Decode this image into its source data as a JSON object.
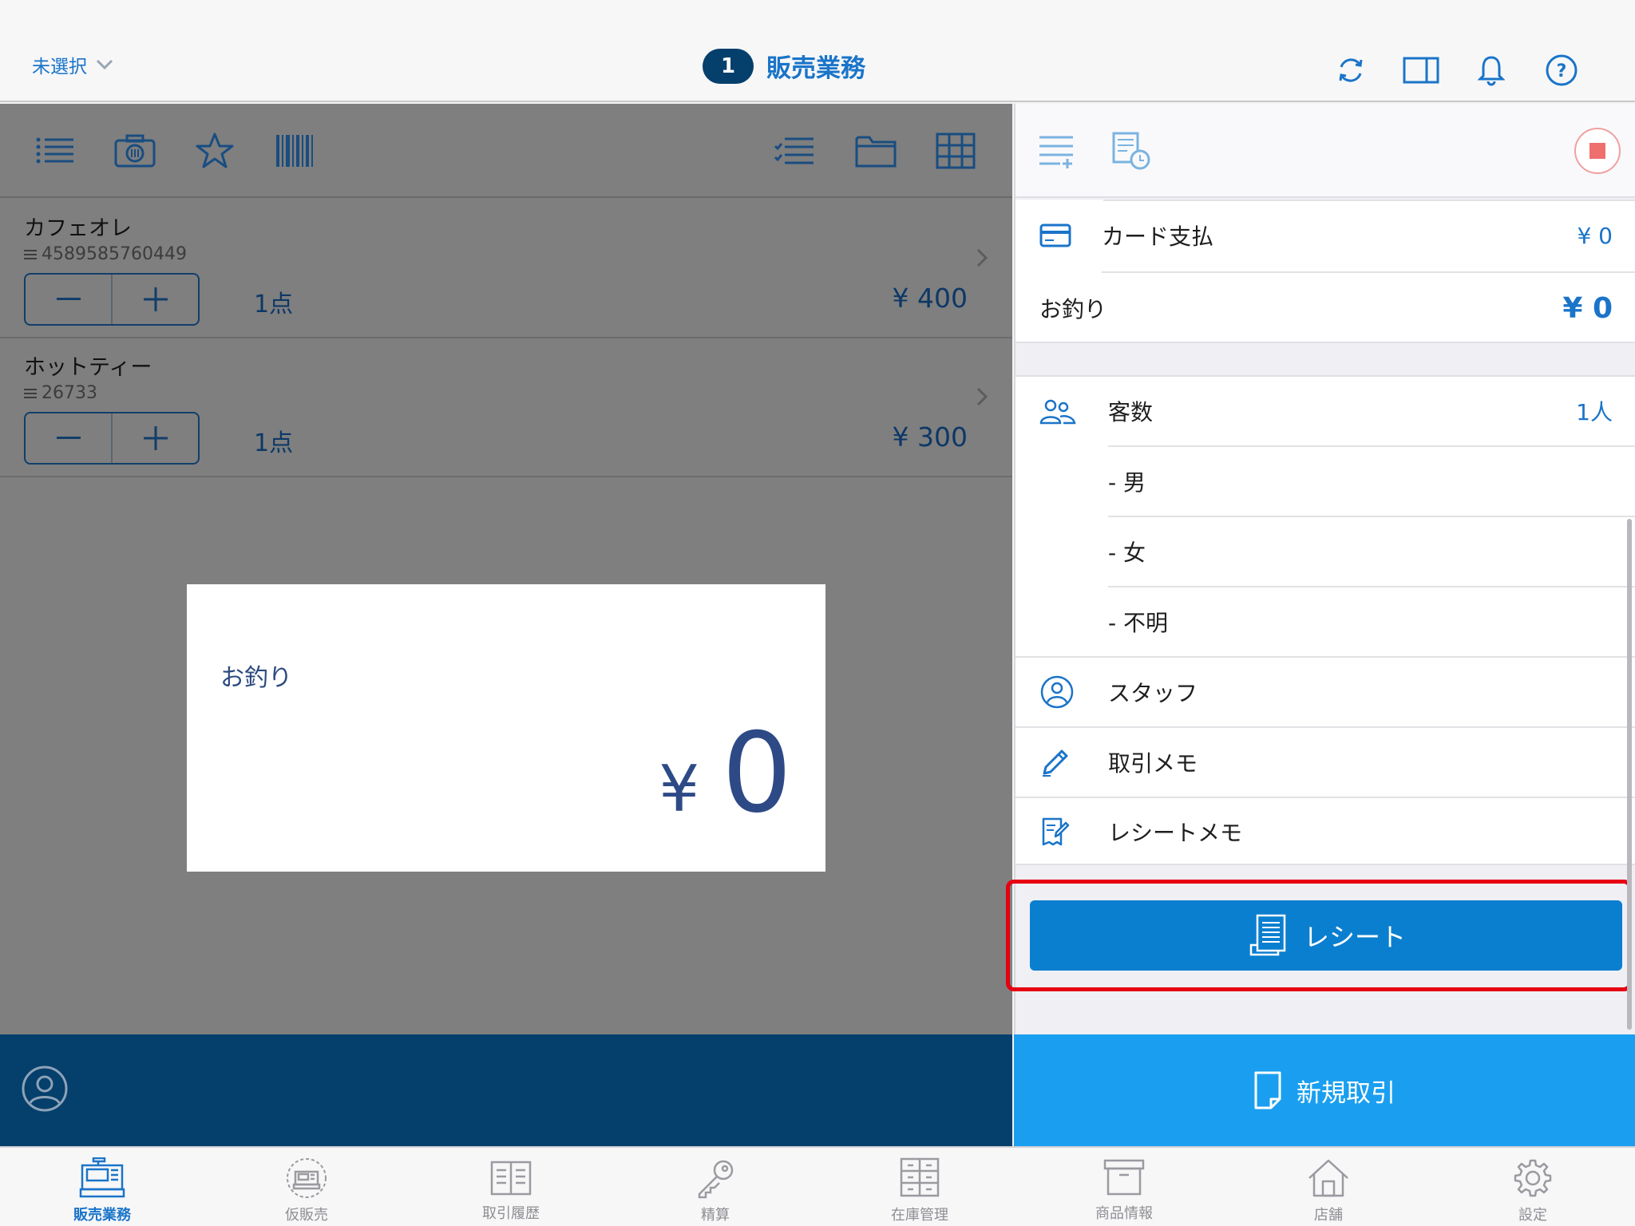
{
  "header": {
    "store_select": "未選択",
    "badge": "1",
    "title": "販売業務"
  },
  "items": [
    {
      "name": "カフェオレ",
      "code": "4589585760449",
      "quantity": "1点",
      "price": "¥ 400"
    },
    {
      "name": "ホットティー",
      "code": "26733",
      "quantity": "1点",
      "price": "¥ 300"
    }
  ],
  "change_card": {
    "label": "お釣り",
    "yen": "¥",
    "amount": "0"
  },
  "payment": {
    "card_label": "カード支払",
    "card_value": "¥ 0",
    "change_label": "お釣り",
    "change_value": "¥ 0"
  },
  "details": {
    "customers_label": "客数",
    "customers_value": "1人",
    "male_label": "- 男",
    "female_label": "- 女",
    "unknown_label": "- 不明",
    "staff_label": "スタッフ",
    "memo_label": "取引メモ",
    "receipt_memo_label": "レシートメモ"
  },
  "receipt_button": "レシート",
  "new_transaction_button": "新規取引",
  "tabs": [
    {
      "label": "販売業務",
      "icon": "register-icon",
      "active": true
    },
    {
      "label": "仮販売",
      "icon": "temp-register-icon",
      "active": false
    },
    {
      "label": "取引履歴",
      "icon": "history-icon",
      "active": false
    },
    {
      "label": "精算",
      "icon": "key-icon",
      "active": false
    },
    {
      "label": "在庫管理",
      "icon": "inventory-icon",
      "active": false
    },
    {
      "label": "商品情報",
      "icon": "box-icon",
      "active": false
    },
    {
      "label": "店舗",
      "icon": "store-icon",
      "active": false
    },
    {
      "label": "設定",
      "icon": "gear-icon",
      "active": false
    }
  ],
  "colors": {
    "accent": "#1a74c9",
    "dark_navy": "#053f6c",
    "button_blue": "#0b7fcf",
    "light_blue": "#1a9ff0",
    "highlight_red": "#e60012"
  }
}
